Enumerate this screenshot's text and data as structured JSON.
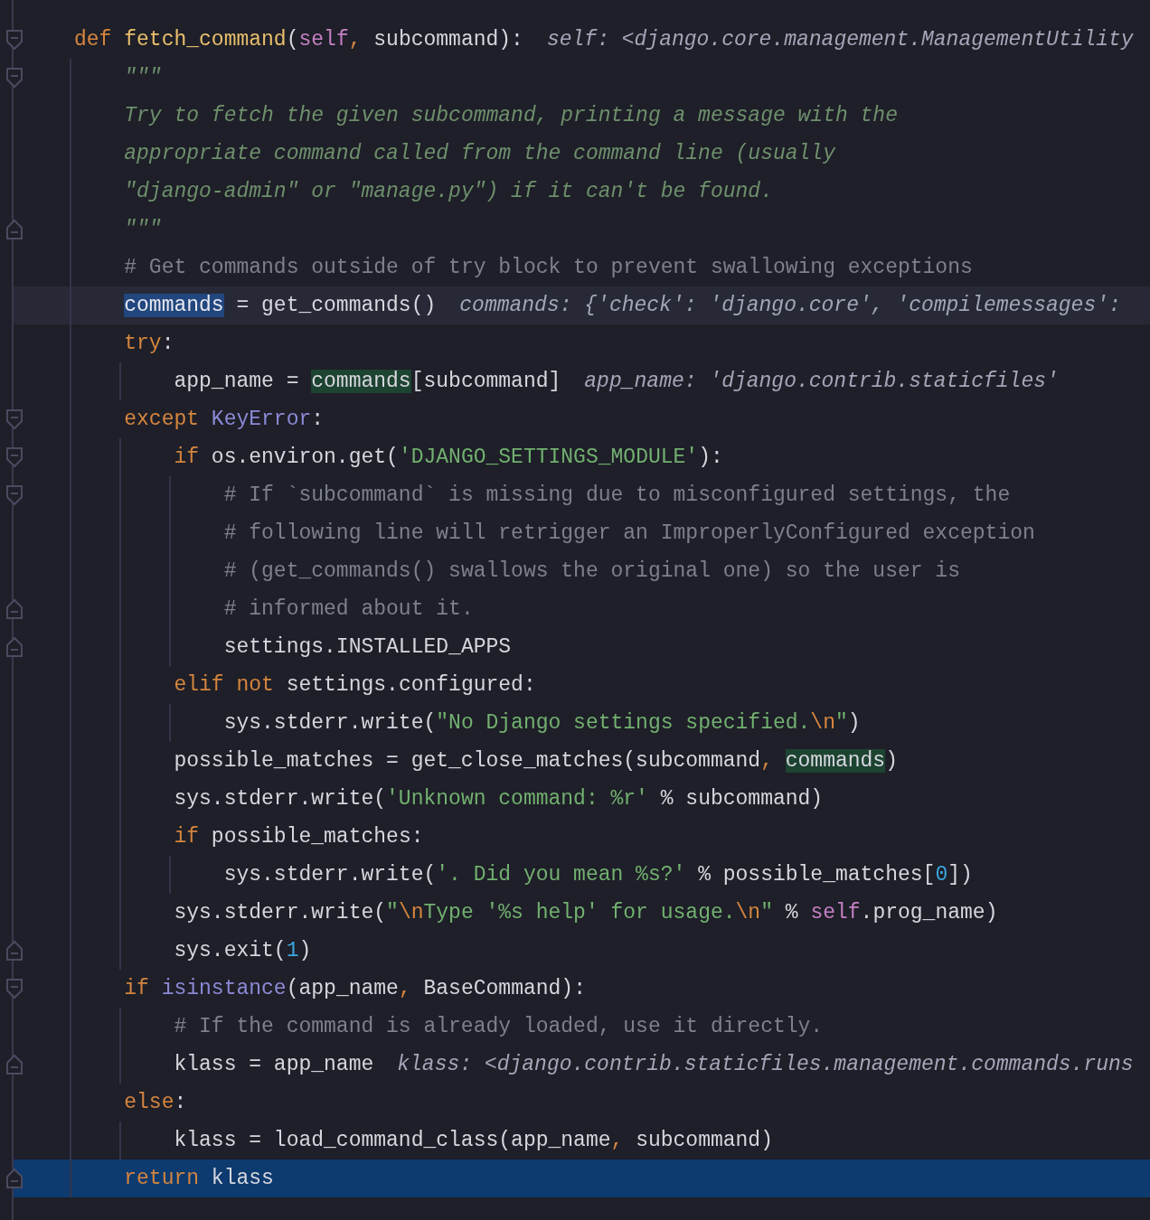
{
  "editor": {
    "lines": [
      {
        "fold_start": true,
        "tokens": [
          {
            "kind": "keyword",
            "text": "def "
          },
          {
            "kind": "function",
            "text": "fetch_command"
          },
          {
            "kind": "plain",
            "text": "("
          },
          {
            "kind": "self",
            "text": "self"
          },
          {
            "kind": "keyword",
            "text": ", "
          },
          {
            "kind": "plain",
            "text": "subcommand):"
          }
        ],
        "hint": "self: <django.core.management.ManagementUtility"
      },
      {
        "fold_start": true,
        "tokens": [
          {
            "kind": "docstring",
            "text": "    \"\"\""
          }
        ]
      },
      {
        "tokens": [
          {
            "kind": "docstring",
            "text": "    Try to fetch the given subcommand, printing a message with the"
          }
        ]
      },
      {
        "tokens": [
          {
            "kind": "docstring",
            "text": "    appropriate command called from the command line (usually"
          }
        ]
      },
      {
        "tokens": [
          {
            "kind": "docstring",
            "text": "    \"django-admin\" or \"manage.py\") if it can't be found."
          }
        ]
      },
      {
        "fold_end": true,
        "tokens": [
          {
            "kind": "docstring",
            "text": "    \"\"\""
          }
        ]
      },
      {
        "tokens": [
          {
            "kind": "comment",
            "text": "    # Get commands outside of try block to prevent swallowing exceptions"
          }
        ]
      },
      {
        "caret": true,
        "tokens": [
          {
            "kind": "selection",
            "text": "    commands"
          },
          {
            "kind": "plain",
            "text": " = get_commands()"
          }
        ],
        "hint": "commands: {'check': 'django.core', 'compilemessages':"
      },
      {
        "tokens": [
          {
            "kind": "keyword",
            "text": "    try"
          },
          {
            "kind": "plain",
            "text": ":"
          }
        ]
      },
      {
        "tokens": [
          {
            "kind": "plain",
            "text": "        app_name = "
          },
          {
            "kind": "usage",
            "text": "commands"
          },
          {
            "kind": "plain",
            "text": "[subcommand]"
          }
        ],
        "hint": "app_name: 'django.contrib.staticfiles'"
      },
      {
        "fold_start": true,
        "tokens": [
          {
            "kind": "keyword",
            "text": "    except "
          },
          {
            "kind": "builtin",
            "text": "KeyError"
          },
          {
            "kind": "plain",
            "text": ":"
          }
        ]
      },
      {
        "fold_start": true,
        "tokens": [
          {
            "kind": "keyword",
            "text": "        if "
          },
          {
            "kind": "plain",
            "text": "os.environ.get("
          },
          {
            "kind": "string",
            "text": "'DJANGO_SETTINGS_MODULE'"
          },
          {
            "kind": "plain",
            "text": "):"
          }
        ]
      },
      {
        "fold_start": true,
        "tokens": [
          {
            "kind": "comment",
            "text": "            # If `subcommand` is missing due to misconfigured settings, the"
          }
        ]
      },
      {
        "tokens": [
          {
            "kind": "comment",
            "text": "            # following line will retrigger an ImproperlyConfigured exception"
          }
        ]
      },
      {
        "tokens": [
          {
            "kind": "comment",
            "text": "            # (get_commands() swallows the original one) so the user is"
          }
        ]
      },
      {
        "fold_end": true,
        "tokens": [
          {
            "kind": "comment",
            "text": "            # informed about it."
          }
        ]
      },
      {
        "fold_end": true,
        "tokens": [
          {
            "kind": "plain",
            "text": "            settings.INSTALLED_APPS"
          }
        ]
      },
      {
        "tokens": [
          {
            "kind": "keyword",
            "text": "        elif not "
          },
          {
            "kind": "plain",
            "text": "settings.configured:"
          }
        ]
      },
      {
        "tokens": [
          {
            "kind": "plain",
            "text": "            sys.stderr.write("
          },
          {
            "kind": "string",
            "text": "\"No Django settings specified."
          },
          {
            "kind": "escape",
            "text": "\\n"
          },
          {
            "kind": "string",
            "text": "\""
          },
          {
            "kind": "plain",
            "text": ")"
          }
        ]
      },
      {
        "tokens": [
          {
            "kind": "plain",
            "text": "        possible_matches = get_close_matches(subcommand"
          },
          {
            "kind": "keyword",
            "text": ", "
          },
          {
            "kind": "usage",
            "text": "commands"
          },
          {
            "kind": "plain",
            "text": ")"
          }
        ]
      },
      {
        "tokens": [
          {
            "kind": "plain",
            "text": "        sys.stderr.write("
          },
          {
            "kind": "string",
            "text": "'Unknown command: %r'"
          },
          {
            "kind": "plain",
            "text": " % subcommand)"
          }
        ]
      },
      {
        "tokens": [
          {
            "kind": "keyword",
            "text": "        if "
          },
          {
            "kind": "plain",
            "text": "possible_matches:"
          }
        ]
      },
      {
        "tokens": [
          {
            "kind": "plain",
            "text": "            sys.stderr.write("
          },
          {
            "kind": "string",
            "text": "'. Did you mean %s?'"
          },
          {
            "kind": "plain",
            "text": " % possible_matches["
          },
          {
            "kind": "number",
            "text": "0"
          },
          {
            "kind": "plain",
            "text": "])"
          }
        ]
      },
      {
        "tokens": [
          {
            "kind": "plain",
            "text": "        sys.stderr.write("
          },
          {
            "kind": "string",
            "text": "\""
          },
          {
            "kind": "escape",
            "text": "\\n"
          },
          {
            "kind": "string",
            "text": "Type '%s help' for usage."
          },
          {
            "kind": "escape",
            "text": "\\n"
          },
          {
            "kind": "string",
            "text": "\""
          },
          {
            "kind": "plain",
            "text": " % "
          },
          {
            "kind": "self",
            "text": "self"
          },
          {
            "kind": "plain",
            "text": ".prog_name)"
          }
        ]
      },
      {
        "fold_end": true,
        "tokens": [
          {
            "kind": "plain",
            "text": "        sys.exit("
          },
          {
            "kind": "number",
            "text": "1"
          },
          {
            "kind": "plain",
            "text": ")"
          }
        ]
      },
      {
        "fold_start": true,
        "tokens": [
          {
            "kind": "keyword",
            "text": "    if "
          },
          {
            "kind": "builtin",
            "text": "isinstance"
          },
          {
            "kind": "plain",
            "text": "(app_name"
          },
          {
            "kind": "keyword",
            "text": ", "
          },
          {
            "kind": "plain",
            "text": "BaseCommand):"
          }
        ]
      },
      {
        "tokens": [
          {
            "kind": "comment",
            "text": "        # If the command is already loaded, use it directly."
          }
        ]
      },
      {
        "fold_end": true,
        "tokens": [
          {
            "kind": "plain",
            "text": "        klass = app_name"
          }
        ],
        "hint": "klass: <django.contrib.staticfiles.management.commands.runs"
      },
      {
        "tokens": [
          {
            "kind": "keyword",
            "text": "    else"
          },
          {
            "kind": "plain",
            "text": ":"
          }
        ]
      },
      {
        "tokens": [
          {
            "kind": "plain",
            "text": "        klass = load_command_class(app_name"
          },
          {
            "kind": "keyword",
            "text": ", "
          },
          {
            "kind": "plain",
            "text": "subcommand)"
          }
        ]
      },
      {
        "execution_point": true,
        "fold_end": true,
        "tokens": [
          {
            "kind": "keyword",
            "text": "    return "
          },
          {
            "kind": "plain",
            "text": "klass"
          }
        ]
      }
    ]
  }
}
